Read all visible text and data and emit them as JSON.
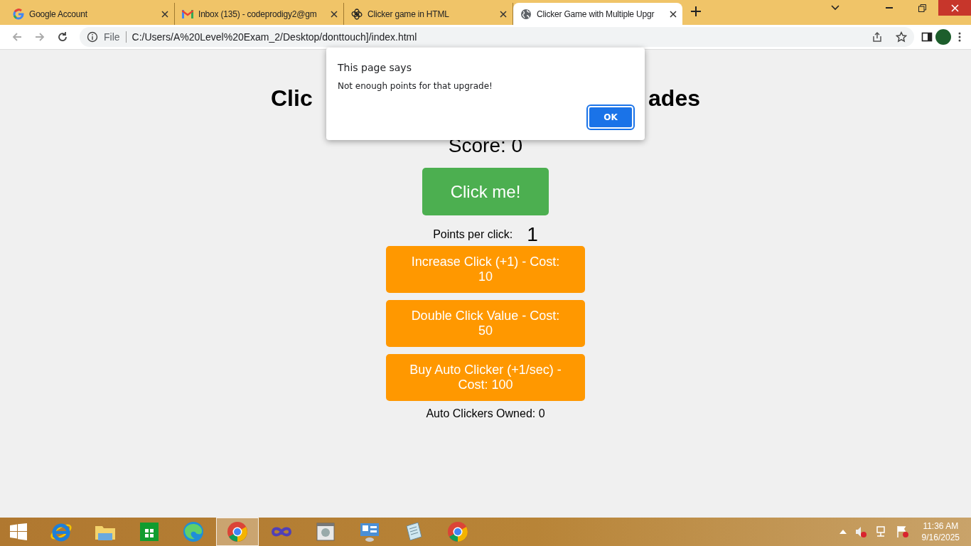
{
  "browser": {
    "tabs": [
      {
        "title": "Google Account",
        "kind": "ring",
        "selected": false
      },
      {
        "title": "Inbox (135) - codeprodigy2@gm",
        "kind": "envelope",
        "selected": false
      },
      {
        "title": "Clicker game in HTML",
        "kind": "flower",
        "selected": false
      },
      {
        "title": "Clicker Game with Multiple Upgr",
        "kind": "globe",
        "selected": true
      }
    ],
    "scheme": "File",
    "url": "C:/Users/A%20Level%20Exam_2/Desktop/donttouch]/index.html"
  },
  "page": {
    "heading_parts": [
      "Clic",
      "ades"
    ],
    "score": "Score: 0",
    "click_button": "Click me!",
    "points_label": "Points per click:",
    "points_value": "1",
    "upgrades": [
      "Increase Click (+1) - Cost: 10",
      "Double Click Value - Cost: 50",
      "Buy Auto Clicker (+1/sec) - Cost: 100"
    ],
    "auto_clickers": "Auto Clickers Owned: 0"
  },
  "dialog": {
    "title": "This page says",
    "message": "Not enough points for that upgrade!",
    "button": "OK"
  },
  "taskbar": {
    "apps": [
      {
        "kind": "ie",
        "selected": false
      },
      {
        "kind": "folder",
        "selected": false
      },
      {
        "kind": "store",
        "selected": false
      },
      {
        "kind": "edge",
        "selected": false
      },
      {
        "kind": "chrome",
        "selected": true
      },
      {
        "kind": "infinity",
        "selected": false
      },
      {
        "kind": "media",
        "selected": false
      },
      {
        "kind": "panel",
        "selected": false
      },
      {
        "kind": "notepad",
        "selected": false
      },
      {
        "kind": "chrome",
        "selected": false
      }
    ],
    "time": "11:36 AM",
    "date": "9/16/2025"
  }
}
